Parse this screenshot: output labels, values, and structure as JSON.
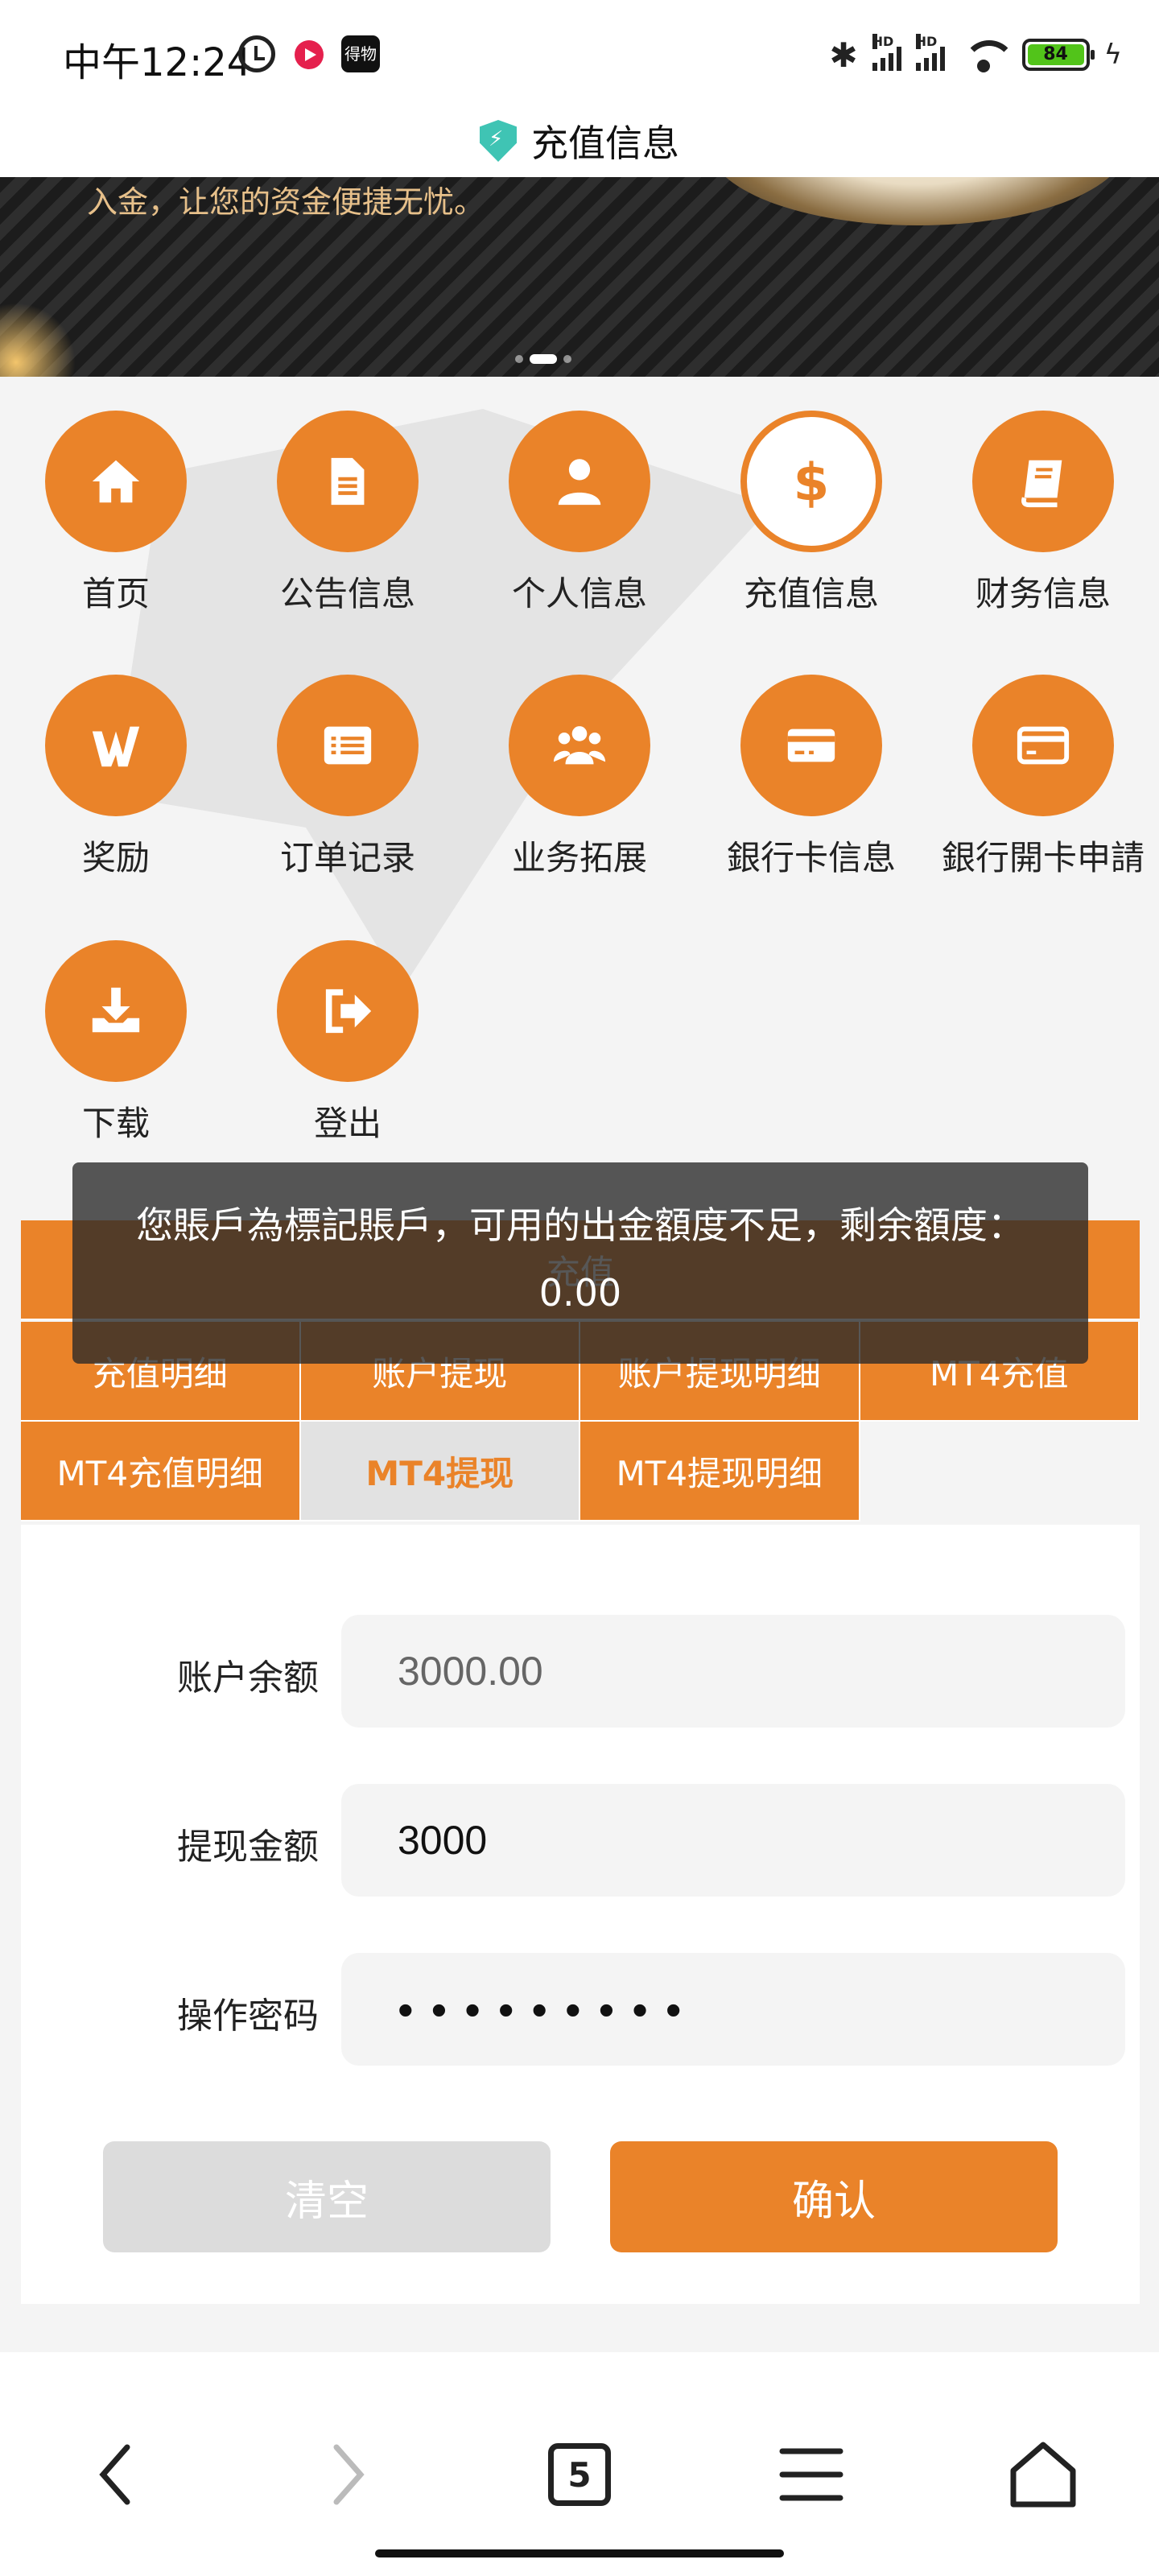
{
  "status_bar": {
    "time": "中午12:24",
    "app_badge": "得物",
    "battery": "84",
    "signal_label": "HD"
  },
  "header": {
    "title": "充值信息"
  },
  "banner": {
    "text": "入金，让您的资金便捷无忧。"
  },
  "menu": {
    "items": [
      {
        "label": "首页",
        "icon": "home-icon"
      },
      {
        "label": "公告信息",
        "icon": "document-icon"
      },
      {
        "label": "个人信息",
        "icon": "user-icon"
      },
      {
        "label": "充值信息",
        "icon": "dollar-icon"
      },
      {
        "label": "财务信息",
        "icon": "book-icon"
      },
      {
        "label": "奖励",
        "icon": "reward-icon"
      },
      {
        "label": "订单记录",
        "icon": "list-icon"
      },
      {
        "label": "业务拓展",
        "icon": "users-icon"
      },
      {
        "label": "銀行卡信息",
        "icon": "card-icon"
      },
      {
        "label": "銀行開卡申請",
        "icon": "card-icon"
      },
      {
        "label": "下载",
        "icon": "download-icon"
      },
      {
        "label": "登出",
        "icon": "logout-icon"
      }
    ]
  },
  "panel": {
    "header": "充值",
    "tabs": [
      "充值明细",
      "账户提现",
      "账户提现明细",
      "MT4充值",
      "MT4充值明细",
      "MT4提现",
      "MT4提现明细"
    ],
    "active_tab": "MT4提现"
  },
  "form": {
    "balance_label": "账户余额",
    "balance_value": "3000.00",
    "amount_label": "提现金额",
    "amount_value": "3000",
    "password_label": "操作密码",
    "password_value": "•••••••••",
    "clear_button": "清空",
    "confirm_button": "确认"
  },
  "toast": {
    "message": "您賬戶為標記賬戶，可用的出金額度不足，剩余額度：0.00"
  },
  "browser_nav": {
    "tab_count": "5"
  },
  "colors": {
    "accent": "#ea8329",
    "shield": "#3fc4b4",
    "battery": "#52c41a"
  }
}
